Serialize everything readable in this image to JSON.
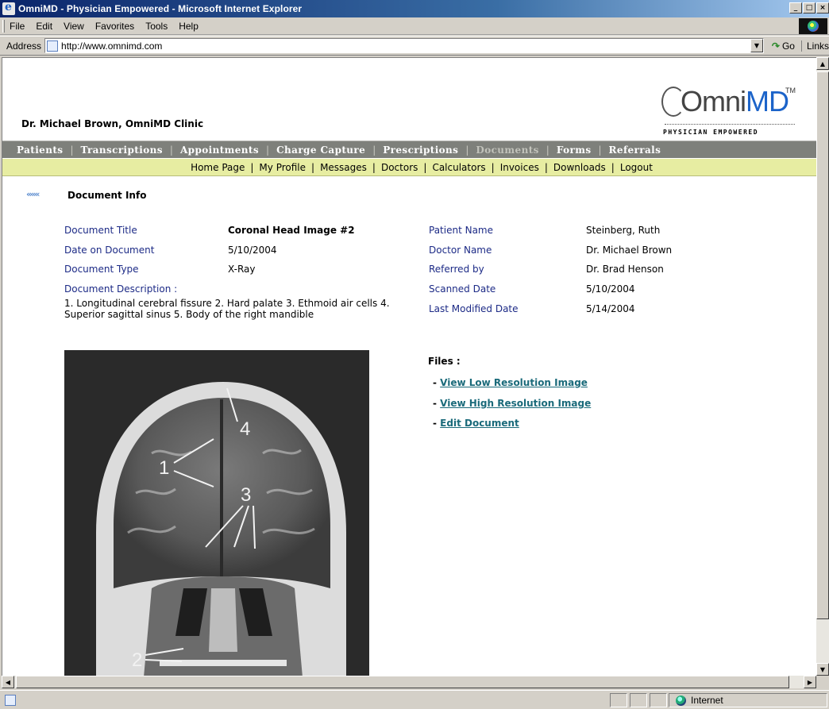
{
  "window": {
    "title": "OmniMD - Physician Empowered - Microsoft Internet Explorer",
    "minimize": "_",
    "maximize": "□",
    "close": "×"
  },
  "menu": {
    "items": [
      "File",
      "Edit",
      "View",
      "Favorites",
      "Tools",
      "Help"
    ]
  },
  "address": {
    "label": "Address",
    "url": "http://www.omnimd.com",
    "go_label": "Go",
    "links_label": "Links"
  },
  "header": {
    "clinic_name": "Dr. Michael Brown, OmniMD Clinic",
    "logo_omni": "Omni",
    "logo_md": "MD",
    "logo_tm": "TM",
    "logo_tagline": "PHYSICIAN EMPOWERED"
  },
  "primary_nav": {
    "items": [
      "Patients",
      "Transcriptions",
      "Appointments",
      "Charge Capture",
      "Prescriptions",
      "Documents",
      "Forms",
      "Referrals"
    ],
    "active": "Documents"
  },
  "secondary_nav": {
    "items": [
      "Home Page",
      "My Profile",
      "Messages",
      "Doctors",
      "Calculators",
      "Invoices",
      "Downloads",
      "Logout"
    ]
  },
  "section": {
    "title": "Document Info"
  },
  "document": {
    "title_label": "Document Title",
    "title_value": "Coronal Head Image #2",
    "date_label": "Date on Document",
    "date_value": "5/10/2004",
    "type_label": "Document Type",
    "type_value": "X-Ray",
    "description_label": "Document Description :",
    "description_value": "1. Longitudinal cerebral fissure 2. Hard palate 3. Ethmoid air cells 4. Superior sagittal sinus 5. Body of the right mandible"
  },
  "patient": {
    "name_label": "Patient Name",
    "name_value": "Steinberg, Ruth",
    "doctor_label": "Doctor Name",
    "doctor_value": "Dr. Michael Brown",
    "referred_label": "Referred by",
    "referred_value": "Dr. Brad Henson",
    "scanned_label": "Scanned Date",
    "scanned_value": "5/10/2004",
    "modified_label": "Last Modified Date",
    "modified_value": "5/14/2004"
  },
  "files": {
    "heading": "Files :",
    "links": [
      "View Low Resolution Image",
      "View High Resolution Image",
      "Edit Document"
    ]
  },
  "image_labels": [
    "1",
    "2",
    "3",
    "4"
  ],
  "status": {
    "zone": "Internet"
  }
}
